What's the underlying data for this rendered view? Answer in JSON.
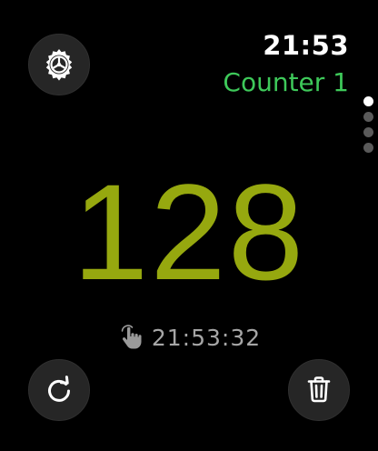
{
  "status": {
    "time": "21:53"
  },
  "counter": {
    "name": "Counter 1",
    "value": "128",
    "last_tap_time": "21:53:32"
  },
  "pager": {
    "page_count": 4,
    "active_page": 1
  },
  "icons": {
    "settings": "gear-icon",
    "reset": "reset-arrow-icon",
    "delete": "trash-icon",
    "tap": "hand-tap-icon"
  },
  "colors": {
    "title": "#3ec95a",
    "count": "#96a80f",
    "time_secondary": "#a6a6a6",
    "button_bg": "#262626"
  }
}
